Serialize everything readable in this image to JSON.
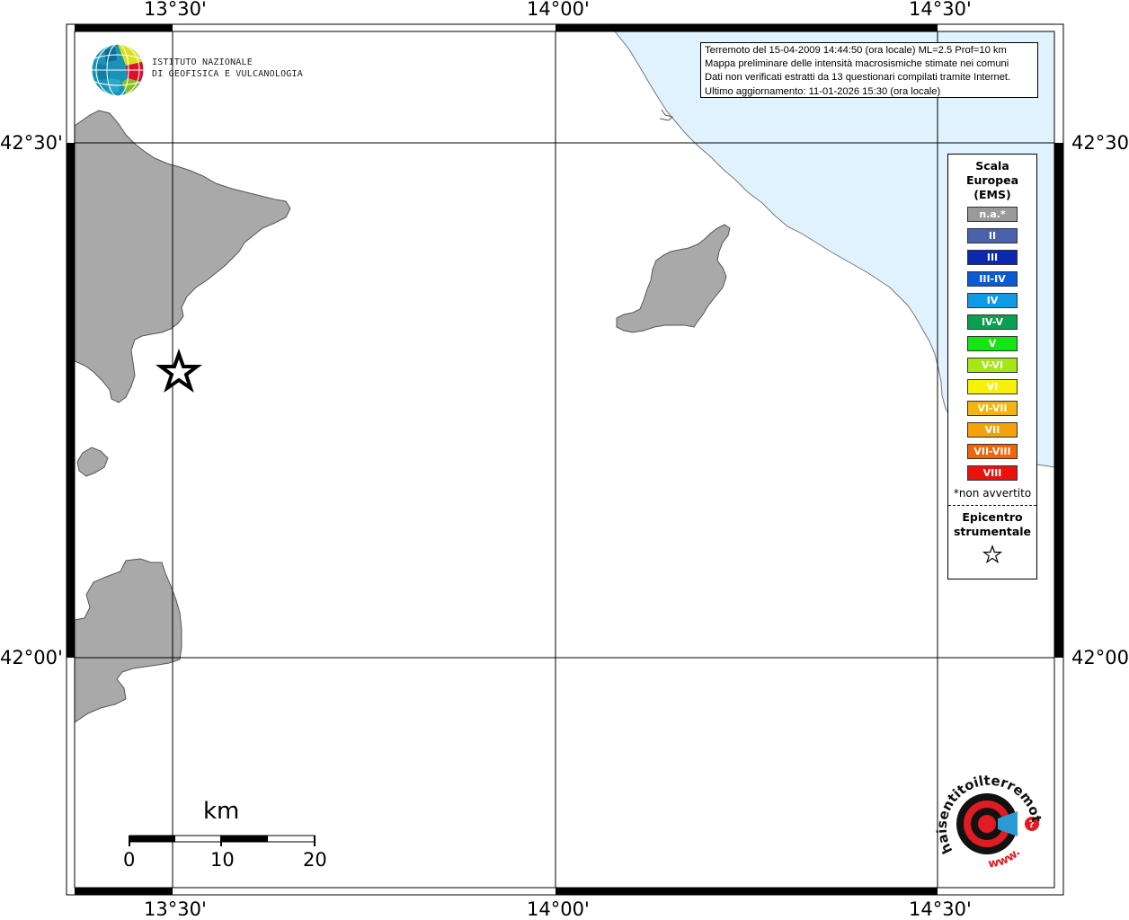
{
  "axes": {
    "top_labels": [
      "13°30'",
      "14°00'",
      "14°30'"
    ],
    "bottom_labels": [
      "13°30'",
      "14°00'",
      "14°30'"
    ],
    "left_labels": [
      "42°30'",
      "42°00'"
    ],
    "right_labels": [
      "42°30'",
      "42°00'"
    ]
  },
  "info": {
    "line1": "Terremoto del 15-04-2009 14:44:50 (ora locale) ML=2.5 Prof=10 km",
    "line2": "Mappa preliminare delle intensità macrosismiche stimate nei comuni",
    "line3": "Dati non verificati estratti da 13 questionari compilati tramite Internet.",
    "line4": "Ultimo aggiornamento: 11-01-2026 15:30 (ora locale)"
  },
  "legend": {
    "title_line1": "Scala",
    "title_line2": "Europea",
    "title_line3": "(EMS)",
    "items": [
      {
        "label": "n.a.*",
        "color": "#9a9a9a"
      },
      {
        "label": "II",
        "color": "#4a62aa"
      },
      {
        "label": "III",
        "color": "#0a28b0"
      },
      {
        "label": "III-IV",
        "color": "#0a5ad2"
      },
      {
        "label": "IV",
        "color": "#0f9ae6"
      },
      {
        "label": "IV-V",
        "color": "#0aa050"
      },
      {
        "label": "V",
        "color": "#12e614"
      },
      {
        "label": "V-VI",
        "color": "#a6e614"
      },
      {
        "label": "VI",
        "color": "#f6f00a"
      },
      {
        "label": "VI-VII",
        "color": "#f6b40a"
      },
      {
        "label": "VII",
        "color": "#f6a00a"
      },
      {
        "label": "VII-VIII",
        "color": "#f0640a"
      },
      {
        "label": "VIII",
        "color": "#e6140a"
      }
    ],
    "note": "*non avvertito",
    "epicenter_line1": "Epicentro",
    "epicenter_line2": "strumentale"
  },
  "logo": {
    "ingv_line1": "ISTITUTO NAZIONALE",
    "ingv_line2": "DI GEOFISICA E VULCANOLOGIA",
    "hst_text": "haisentitoilterremoto.it",
    "hst_www": "www."
  },
  "scale_bar": {
    "title": "km",
    "ticks": [
      "0",
      "10",
      "20"
    ]
  },
  "colors": {
    "land": "#a9a9a9",
    "sea": "#e0f2fd",
    "frame": "#000000"
  }
}
